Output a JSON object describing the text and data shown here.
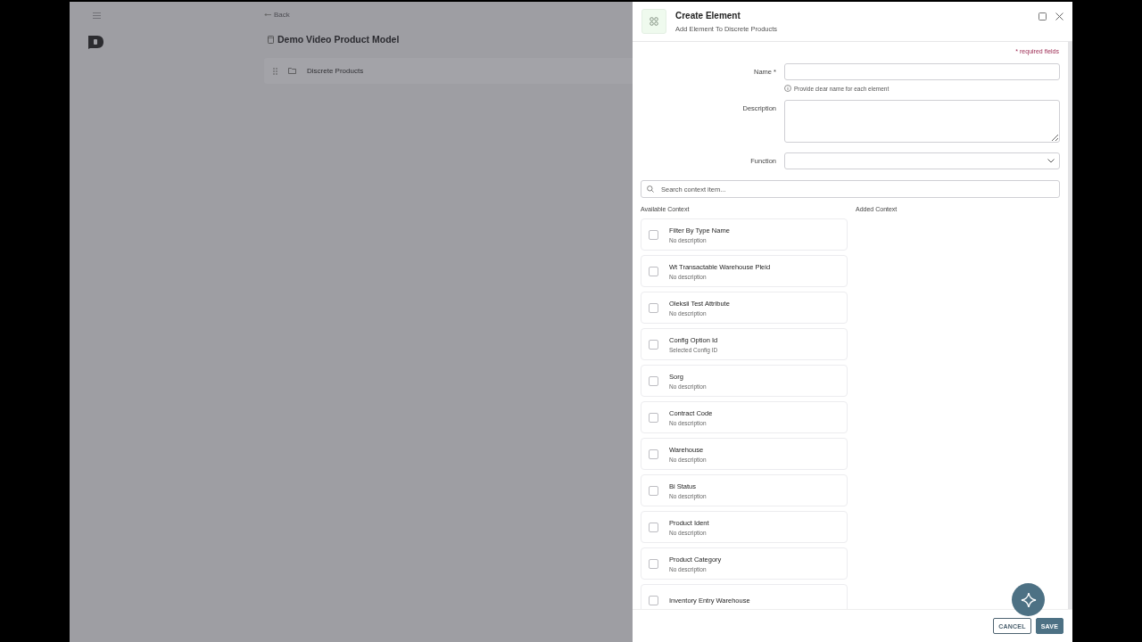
{
  "background": {
    "back": "Back",
    "title": "Demo Video Product Model",
    "rows": [
      {
        "label": "Discrete Products"
      }
    ]
  },
  "drawer": {
    "title": "Create Element",
    "subtitle": "Add Element To Discrete Products",
    "required_note": "* required fields",
    "fields": [
      {
        "kind": "text",
        "label": "Name *",
        "hint": "Provide clear name for each element"
      },
      {
        "kind": "textarea",
        "label": "Description"
      },
      {
        "kind": "select",
        "label": "Function"
      }
    ],
    "search": {
      "placeholder": "Search context item..."
    },
    "available_heading": "Available Context",
    "added_heading": "Added Context",
    "items": [
      {
        "title": "Filter By Type Name",
        "description": "No description",
        "checked": false
      },
      {
        "title": "Wt Transactable Warehouse Pleid",
        "description": "No description",
        "checked": false
      },
      {
        "title": "Oleksii Test Attribute",
        "description": "No description",
        "checked": false
      },
      {
        "title": "Config Option Id",
        "description": "Selected Config ID",
        "checked": false
      },
      {
        "title": "Sorg",
        "description": "No description",
        "checked": false
      },
      {
        "title": "Contract Code",
        "description": "No description",
        "checked": false
      },
      {
        "title": "Warehouse",
        "description": "No description",
        "checked": false
      },
      {
        "title": "Bi Status",
        "description": "No description",
        "checked": false
      },
      {
        "title": "Product Ident",
        "description": "No description",
        "checked": false
      },
      {
        "title": "Product Category",
        "description": "No description",
        "checked": false
      },
      {
        "title": "Inventory Entry Warehouse",
        "checked": false
      }
    ],
    "buttons": [
      {
        "kind": "secondary",
        "label": "CANCEL"
      },
      {
        "kind": "primary",
        "label": "SAVE"
      }
    ]
  }
}
